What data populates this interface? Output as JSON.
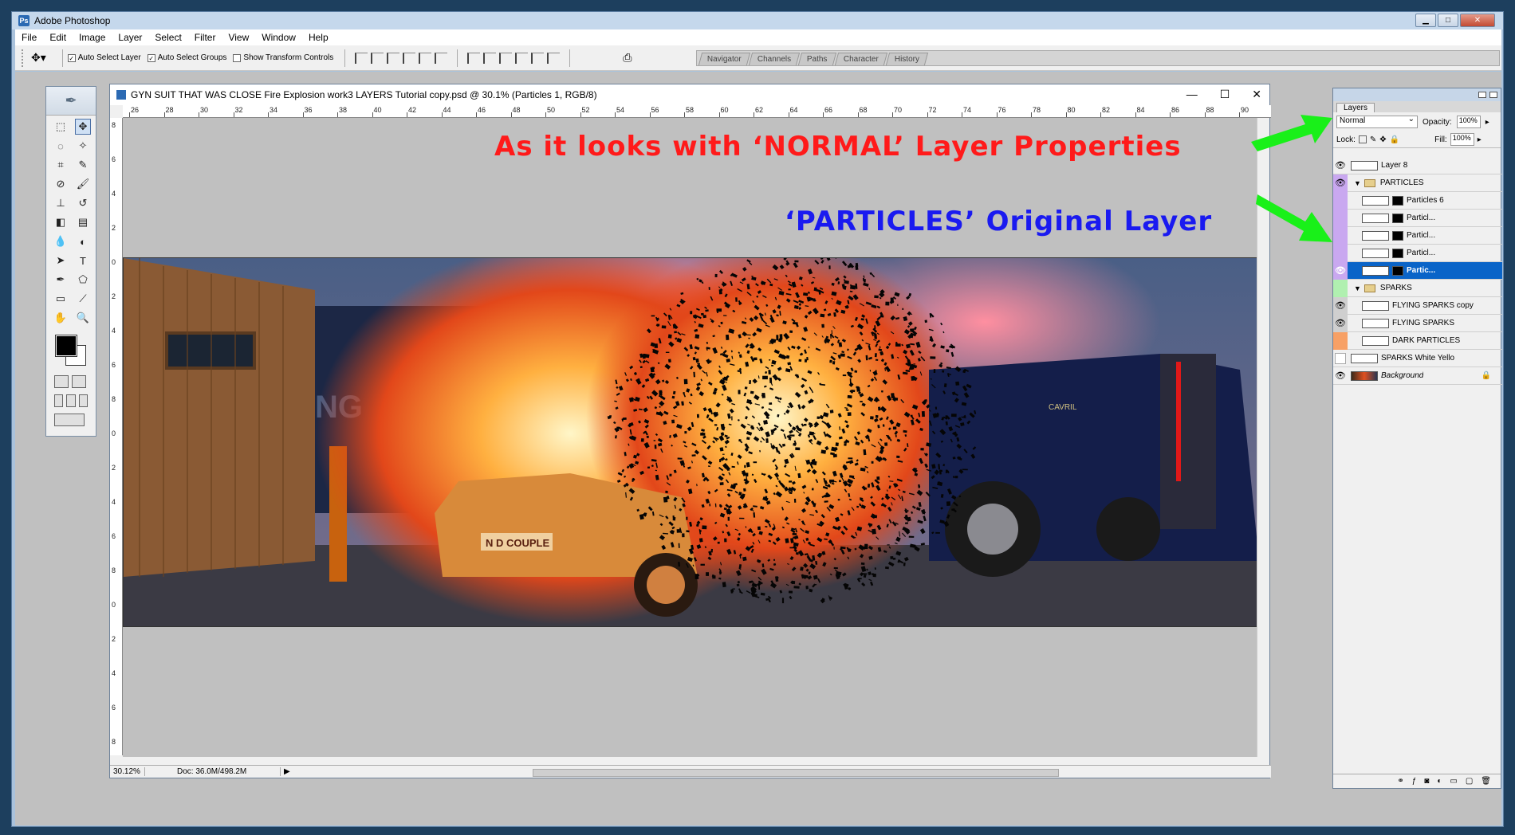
{
  "app": {
    "title": "Adobe Photoshop"
  },
  "menu": [
    "File",
    "Edit",
    "Image",
    "Layer",
    "Select",
    "Filter",
    "View",
    "Window",
    "Help"
  ],
  "options": {
    "auto_select_layer": "Auto Select Layer",
    "auto_select_groups": "Auto Select Groups",
    "show_transform_controls": "Show Transform Controls"
  },
  "wells": [
    "Navigator",
    "Channels",
    "Paths",
    "Character",
    "History"
  ],
  "document": {
    "title": "GYN SUIT THAT WAS CLOSE Fire Explosion work3 LAYERS Tutorial copy.psd @ 30.1% (Particles 1, RGB/8)",
    "ruler_h": [
      "26",
      "28",
      "30",
      "32",
      "34",
      "36",
      "38",
      "40",
      "42",
      "44",
      "46",
      "48",
      "50",
      "52",
      "54",
      "56",
      "58",
      "60",
      "62",
      "64",
      "66",
      "68",
      "70",
      "72",
      "74",
      "76",
      "78",
      "80",
      "82",
      "84",
      "86",
      "88",
      "90"
    ],
    "ruler_v": [
      "8",
      "6",
      "4",
      "2",
      "0",
      "2",
      "4",
      "6",
      "8",
      "0",
      "2",
      "4",
      "6",
      "8",
      "0",
      "2",
      "4",
      "6",
      "8",
      "2"
    ],
    "zoom": "30.12%",
    "doc_size": "Doc: 36.0M/498.2M"
  },
  "annotations": {
    "normal": "As it looks with ‘NORMAL’ Layer Properties",
    "particles": "‘PARTICLES’ Original Layer"
  },
  "photo_text": {
    "truck_badge": "CAVRIL",
    "plate": "N D COUPLE",
    "container": "NG"
  },
  "layers_panel": {
    "tab": "Layers",
    "blend_mode": "Normal",
    "opacity_label": "Opacity:",
    "opacity": "100%",
    "lock_label": "Lock:",
    "fill_label": "Fill:",
    "fill": "100%",
    "layers": [
      {
        "name": "Layer 8",
        "eye": "visible",
        "tag": "none",
        "kind": "layer"
      },
      {
        "name": "PARTICLES",
        "eye": "visible",
        "tag": "purple",
        "kind": "group"
      },
      {
        "name": "Particles 6",
        "eye": "",
        "tag": "purple",
        "kind": "child"
      },
      {
        "name": "Particl...",
        "eye": "",
        "tag": "purple",
        "kind": "child"
      },
      {
        "name": "Particl...",
        "eye": "",
        "tag": "purple",
        "kind": "child"
      },
      {
        "name": "Particl...",
        "eye": "",
        "tag": "purple",
        "kind": "child"
      },
      {
        "name": "Partic...",
        "eye": "visible",
        "tag": "purple",
        "kind": "child-active"
      },
      {
        "name": "SPARKS",
        "eye": "",
        "tag": "green",
        "kind": "group"
      },
      {
        "name": "FLYING SPARKS copy",
        "eye": "visible",
        "tag": "gray",
        "kind": "child"
      },
      {
        "name": "FLYING SPARKS",
        "eye": "visible",
        "tag": "gray",
        "kind": "child"
      },
      {
        "name": "DARK PARTICLES",
        "eye": "",
        "tag": "orange",
        "kind": "child"
      },
      {
        "name": "SPARKS White Yello",
        "eye": "",
        "tag": "blank",
        "kind": "layer"
      },
      {
        "name": "Background",
        "eye": "visible",
        "tag": "none",
        "kind": "background"
      }
    ]
  },
  "colors": {
    "annotation_red": "#ff1a1a",
    "annotation_blue": "#1a1af0",
    "arrow_green": "#19f019",
    "active_layer": "#0a64c8"
  }
}
